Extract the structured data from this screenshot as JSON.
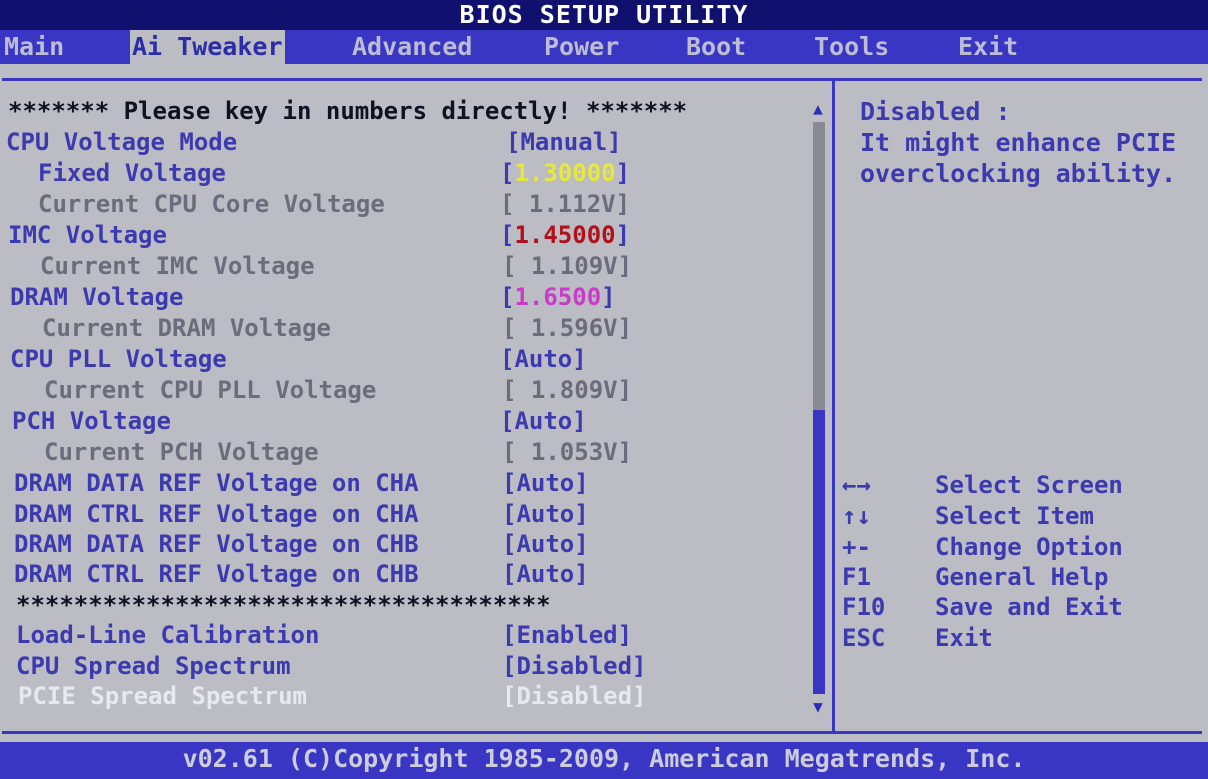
{
  "title": "BIOS SETUP UTILITY",
  "tabs": [
    "Main",
    "Ai Tweaker",
    "Advanced",
    "Power",
    "Boot",
    "Tools",
    "Exit"
  ],
  "notice": "******* Please key in numbers directly! *******",
  "settings": [
    {
      "label": "CPU Voltage Mode",
      "value": "[Manual]"
    },
    {
      "label": "Fixed Voltage",
      "value_open": "[",
      "value_num": "1.30000",
      "value_close": "]"
    },
    {
      "label": "Current CPU Core Voltage",
      "value": "[ 1.112V]"
    },
    {
      "label": "IMC Voltage",
      "value_open": "[",
      "value_num": "1.45000",
      "value_close": "]"
    },
    {
      "label": "Current IMC Voltage",
      "value": "[ 1.109V]"
    },
    {
      "label": "DRAM Voltage",
      "value_open": "[",
      "value_num": "1.6500",
      "value_close": "]"
    },
    {
      "label": "Current DRAM Voltage",
      "value": "[ 1.596V]"
    },
    {
      "label": "CPU PLL Voltage",
      "value": "[Auto]"
    },
    {
      "label": "Current CPU PLL Voltage",
      "value": "[ 1.809V]"
    },
    {
      "label": "PCH Voltage",
      "value": "[Auto]"
    },
    {
      "label": "Current PCH Voltage",
      "value": "[ 1.053V]"
    },
    {
      "label": "DRAM DATA REF Voltage on CHA",
      "value": "[Auto]"
    },
    {
      "label": "DRAM CTRL REF Voltage on CHA",
      "value": "[Auto]"
    },
    {
      "label": "DRAM DATA REF Voltage on CHB",
      "value": "[Auto]"
    },
    {
      "label": "DRAM CTRL REF Voltage on CHB",
      "value": "[Auto]"
    }
  ],
  "separator": "*************************************",
  "settings2": [
    {
      "label": "Load-Line Calibration",
      "value": "[Enabled]"
    },
    {
      "label": "CPU Spread Spectrum",
      "value": "[Disabled]"
    },
    {
      "label": "PCIE Spread Spectrum",
      "value": "[Disabled]"
    }
  ],
  "help": [
    "Disabled :",
    "It might enhance PCIE",
    "overclocking ability."
  ],
  "keys": [
    {
      "key": "←→",
      "desc": "Select Screen"
    },
    {
      "key": "↑↓",
      "desc": "Select Item"
    },
    {
      "key": "+-",
      "desc": "Change Option"
    },
    {
      "key": "F1",
      "desc": "General Help"
    },
    {
      "key": "F10",
      "desc": "Save and Exit"
    },
    {
      "key": "ESC",
      "desc": "Exit"
    }
  ],
  "scrollbar": {
    "up_icon": "▲",
    "down_icon": "▼"
  },
  "footer": "v02.61 (C)Copyright 1985-2009, American Megatrends, Inc."
}
